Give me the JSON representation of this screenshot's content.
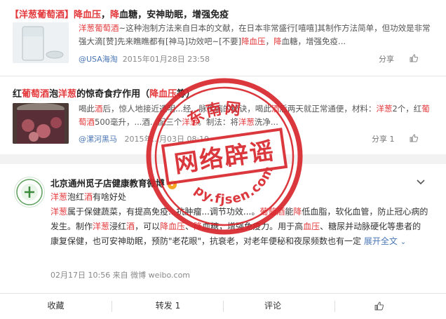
{
  "results": [
    {
      "title_parts": [
        {
          "t": "【洋葱葡萄酒】",
          "hl": true
        },
        {
          "t": "降血压",
          "hl": true
        },
        {
          "t": "，",
          "hl": false
        },
        {
          "t": "降",
          "hl": true
        },
        {
          "t": "血糖，安神助眠，增强免疫",
          "hl": false
        }
      ],
      "snippet_parts": [
        {
          "t": "洋葱葡萄酒",
          "hl": true
        },
        {
          "t": "~这种泡制方法来自日本的文献，在日本非常盛行[嘻嘻]其制作方法简单，但功效是非常强大滴[赞]先来瞧瞧都有[神马]功效吧~[不要]",
          "hl": false
        },
        {
          "t": "降血压",
          "hl": true
        },
        {
          "t": "，",
          "hl": false
        },
        {
          "t": "降",
          "hl": true
        },
        {
          "t": "血糖，增强免疫...",
          "hl": false
        }
      ],
      "source": "@USA海淘",
      "date": "2015年01月28日 23:58",
      "share_label": "分享"
    },
    {
      "title_parts": [
        {
          "t": "红",
          "hl": false
        },
        {
          "t": "葡萄酒",
          "hl": true
        },
        {
          "t": "泡",
          "hl": false
        },
        {
          "t": "洋葱",
          "hl": true
        },
        {
          "t": "的惊奇食疗作用（",
          "hl": false
        },
        {
          "t": "降血压",
          "hl": true
        },
        {
          "t": "等）",
          "hl": false
        }
      ],
      "snippet_parts": [
        {
          "t": "喝此",
          "hl": false
        },
        {
          "t": "酒",
          "hl": true
        },
        {
          "t": "后，惊人地接近透明...经...脉疾病的秘诀，喝此",
          "hl": false
        },
        {
          "t": "酒",
          "hl": true
        },
        {
          "t": "后两天就正常通便，材料：",
          "hl": false
        },
        {
          "t": "洋葱",
          "hl": true
        },
        {
          "t": "2个，红",
          "hl": false
        },
        {
          "t": "葡萄酒",
          "hl": true
        },
        {
          "t": "500毫升，...酒...配三个",
          "hl": false
        },
        {
          "t": "洋葱",
          "hl": true
        },
        {
          "t": "。制法：将",
          "hl": false
        },
        {
          "t": "洋葱",
          "hl": true
        },
        {
          "t": "洗净...",
          "hl": false
        }
      ],
      "source": "@漯河黑马",
      "date": "2015年...月03日 08:19",
      "share_label": "分享 1"
    }
  ],
  "weibo": {
    "account_name": "北京通州觅子店健康教育微博",
    "verified_badge": "V",
    "subtitle_parts": [
      {
        "t": "洋葱",
        "hl": true
      },
      {
        "t": "泡红",
        "hl": false
      },
      {
        "t": "酒",
        "hl": true
      },
      {
        "t": "有啥好处",
        "hl": false
      }
    ],
    "body_parts": [
      {
        "t": "洋葱",
        "hl": true
      },
      {
        "t": "属于保健蔬菜，有提高免疫...抗肿瘤...调节功效...。",
        "hl": false
      },
      {
        "t": "葡萄酒",
        "hl": true
      },
      {
        "t": "能",
        "hl": false
      },
      {
        "t": "降",
        "hl": true
      },
      {
        "t": "低血脂，软化血管，防止冠心病的发生。制作",
        "hl": false
      },
      {
        "t": "洋葱",
        "hl": true
      },
      {
        "t": "浸红",
        "hl": false
      },
      {
        "t": "酒",
        "hl": true
      },
      {
        "t": "，可以",
        "hl": false
      },
      {
        "t": "降血压",
        "hl": true
      },
      {
        "t": "、",
        "hl": false
      },
      {
        "t": "降",
        "hl": true
      },
      {
        "t": "血糖，增强免疫力。用于高",
        "hl": false
      },
      {
        "t": "血压",
        "hl": true
      },
      {
        "t": "、糖尿并动脉硬化等患者的康复保健，也可安神助眠，预防\"老花眼\"，抗衰老，对老年便秘和夜尿频数也有一定",
        "hl": false
      }
    ],
    "expand_label": "展开全文",
    "timestamp": "02月17日 10:56 来自 微博 weibo.com"
  },
  "actions": {
    "favorite": "收藏",
    "repost": "转发 1",
    "comment": "评论"
  },
  "watermark": {
    "top_text": "东南网",
    "main_text": "网络辟谣",
    "url_text": "py.fjsen.com"
  },
  "colors": {
    "highlight": "#e4393c",
    "link": "#4a76b5",
    "seal": "#d8232a"
  }
}
